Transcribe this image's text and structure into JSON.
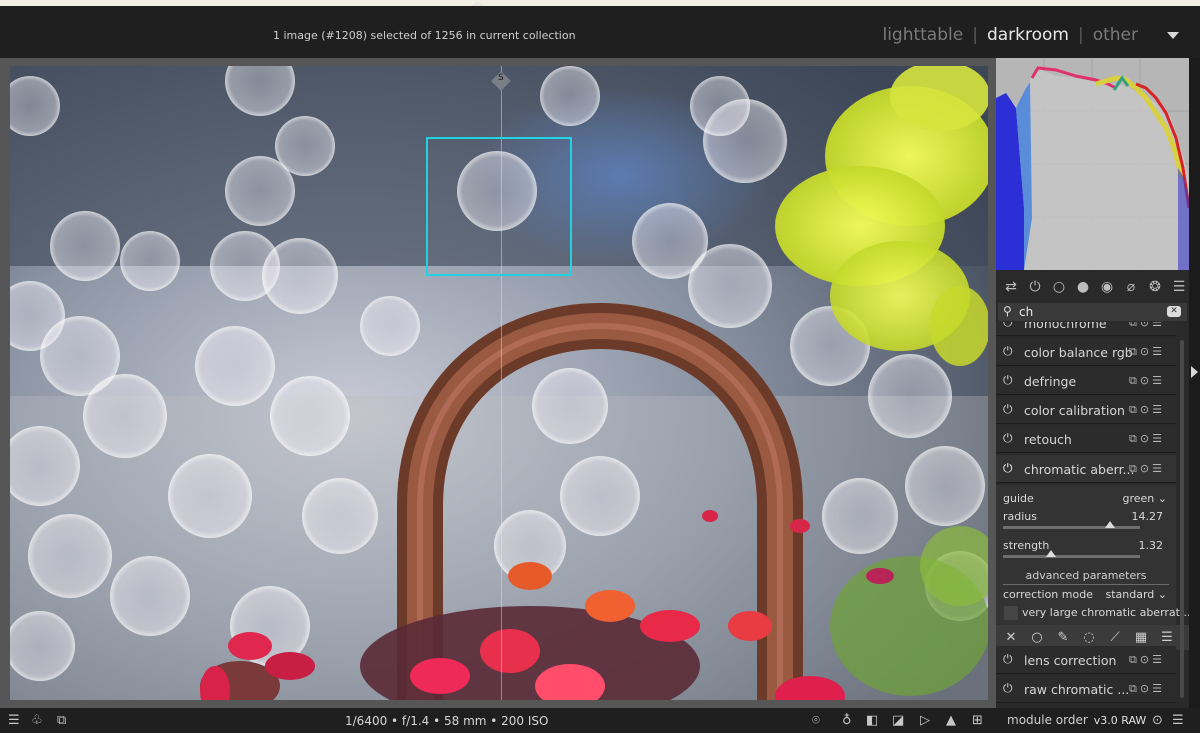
{
  "header": {
    "status": "1 image (#1208) selected of 1256 in current collection",
    "views": [
      "lighttable",
      "darkroom",
      "other"
    ],
    "active_view": "darkroom"
  },
  "image": {
    "split_marker": "S",
    "focus_color": "#21d3e0"
  },
  "footer": {
    "left_icons": [
      "menu-icon",
      "styles-icon",
      "display-icon"
    ],
    "exif": "1/6400 • f/1.4 • 58 mm • 200 ISO",
    "right_icons": [
      "focus-peaking-icon",
      "bulb-icon",
      "softproof-icon",
      "gamut-icon",
      "overexposed-icon",
      "warning-icon",
      "grid-icon"
    ],
    "module_order_label": "module order",
    "module_order_value": "v3.0 RAW"
  },
  "panel": {
    "group_tabs": [
      "presets-icon",
      "power-icon",
      "circle-icon",
      "tone-icon",
      "color-icon",
      "correct-icon",
      "effect-icon",
      "menu-icon"
    ],
    "search_value": "ch",
    "modules": [
      {
        "name": "monochrome"
      },
      {
        "name": "color balance rgb"
      },
      {
        "name": "defringe"
      },
      {
        "name": "color calibration"
      },
      {
        "name": "retouch"
      },
      {
        "name": "chromatic aberr..."
      },
      {
        "name": "lens correction"
      },
      {
        "name": "raw chromatic ..."
      }
    ],
    "chromatic": {
      "guide_label": "guide",
      "guide_value": "green",
      "radius_label": "radius",
      "radius_value": "14.27",
      "radius_fraction": 0.78,
      "strength_label": "strength",
      "strength_value": "1.32",
      "strength_fraction": 0.35,
      "advanced_label": "advanced parameters",
      "correction_mode_label": "correction mode",
      "correction_mode_value": "standard",
      "checkbox_label": "very large chromatic aberrat..."
    },
    "mask_icons": [
      "off-icon",
      "uniform-icon",
      "drawn-icon",
      "parametric-icon",
      "drawn-parametric-icon",
      "raster-icon",
      "menu-icon"
    ]
  }
}
